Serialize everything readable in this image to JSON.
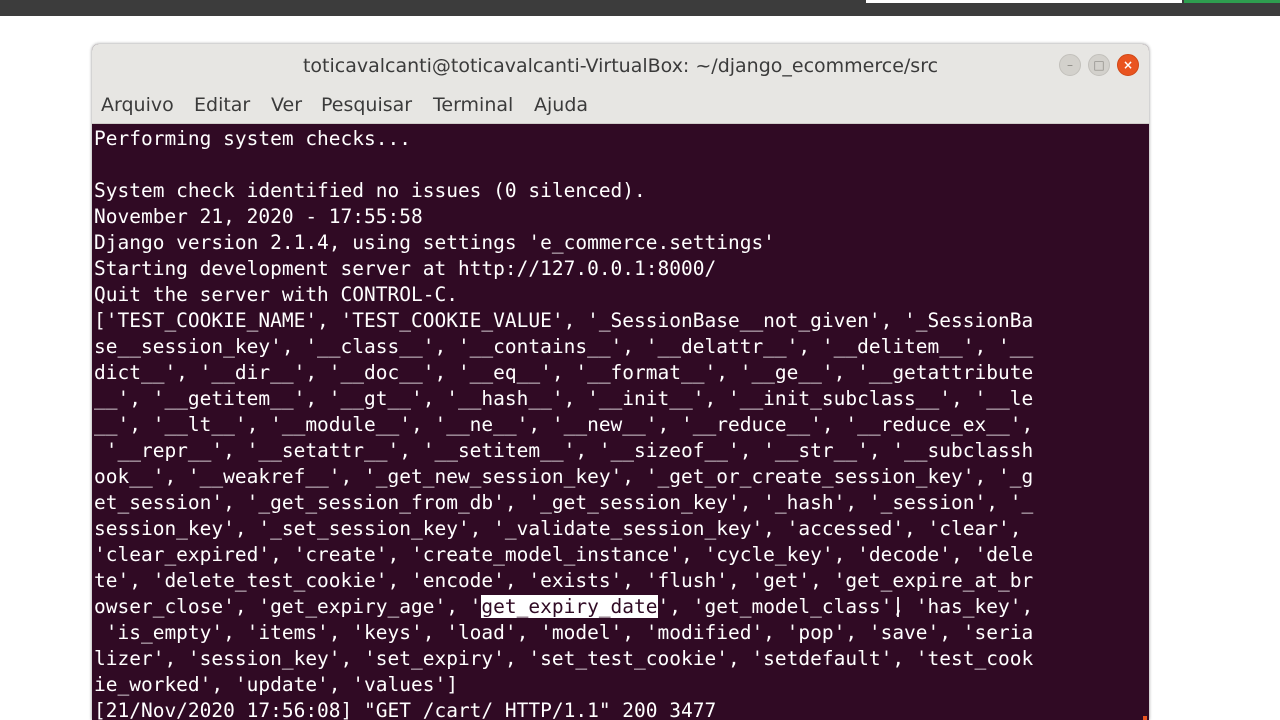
{
  "window": {
    "title": "toticavalcanti@toticavalcanti-VirtualBox: ~/django_ecommerce/src",
    "buttons": {
      "minimize": "–",
      "maximize": "□",
      "close": "×"
    }
  },
  "menubar": {
    "items": [
      "Arquivo",
      "Editar",
      "Ver",
      "Pesquisar",
      "Terminal",
      "Ajuda"
    ]
  },
  "terminal": {
    "colors": {
      "background": "#300a24",
      "foreground": "#ffffff",
      "accent": "#e95420"
    },
    "lines": [
      "Performing system checks...",
      "",
      "System check identified no issues (0 silenced).",
      "November 21, 2020 - 17:55:58",
      "Django version 2.1.4, using settings 'e_commerce.settings'",
      "Starting development server at http://127.0.0.1:8000/",
      "Quit the server with CONTROL-C.",
      "['TEST_COOKIE_NAME', 'TEST_COOKIE_VALUE', '_SessionBase__not_given', '_SessionBa",
      "se__session_key', '__class__', '__contains__', '__delattr__', '__delitem__', '__",
      "dict__', '__dir__', '__doc__', '__eq__', '__format__', '__ge__', '__getattribute",
      "__', '__getitem__', '__gt__', '__hash__', '__init__', '__init_subclass__', '__le",
      "__', '__lt__', '__module__', '__ne__', '__new__', '__reduce__', '__reduce_ex__',",
      " '__repr__', '__setattr__', '__setitem__', '__sizeof__', '__str__', '__subclassh",
      "ook__', '__weakref__', '_get_new_session_key', '_get_or_create_session_key', '_g",
      "et_session', '_get_session_from_db', '_get_session_key', '_hash', '_session', '_",
      "session_key', '_set_session_key', '_validate_session_key', 'accessed', 'clear',",
      "'clear_expired', 'create', 'create_model_instance', 'cycle_key', 'decode', 'dele",
      "te', 'delete_test_cookie', 'encode', 'exists', 'flush', 'get', 'get_expire_at_br",
      {
        "before": "owser_close', 'get_expiry_age', '",
        "selected": "get_expiry_date",
        "after": "', 'get_model_class', 'has_key',"
      },
      " 'is_empty', 'items', 'keys', 'load', 'model', 'modified', 'pop', 'save', 'seria",
      "lizer', 'session_key', 'set_expiry', 'set_test_cookie', 'setdefault', 'test_cook",
      "ie_worked', 'update', 'values']",
      "[21/Nov/2020 17:56:08] \"GET /cart/ HTTP/1.1\" 200 3477"
    ]
  }
}
